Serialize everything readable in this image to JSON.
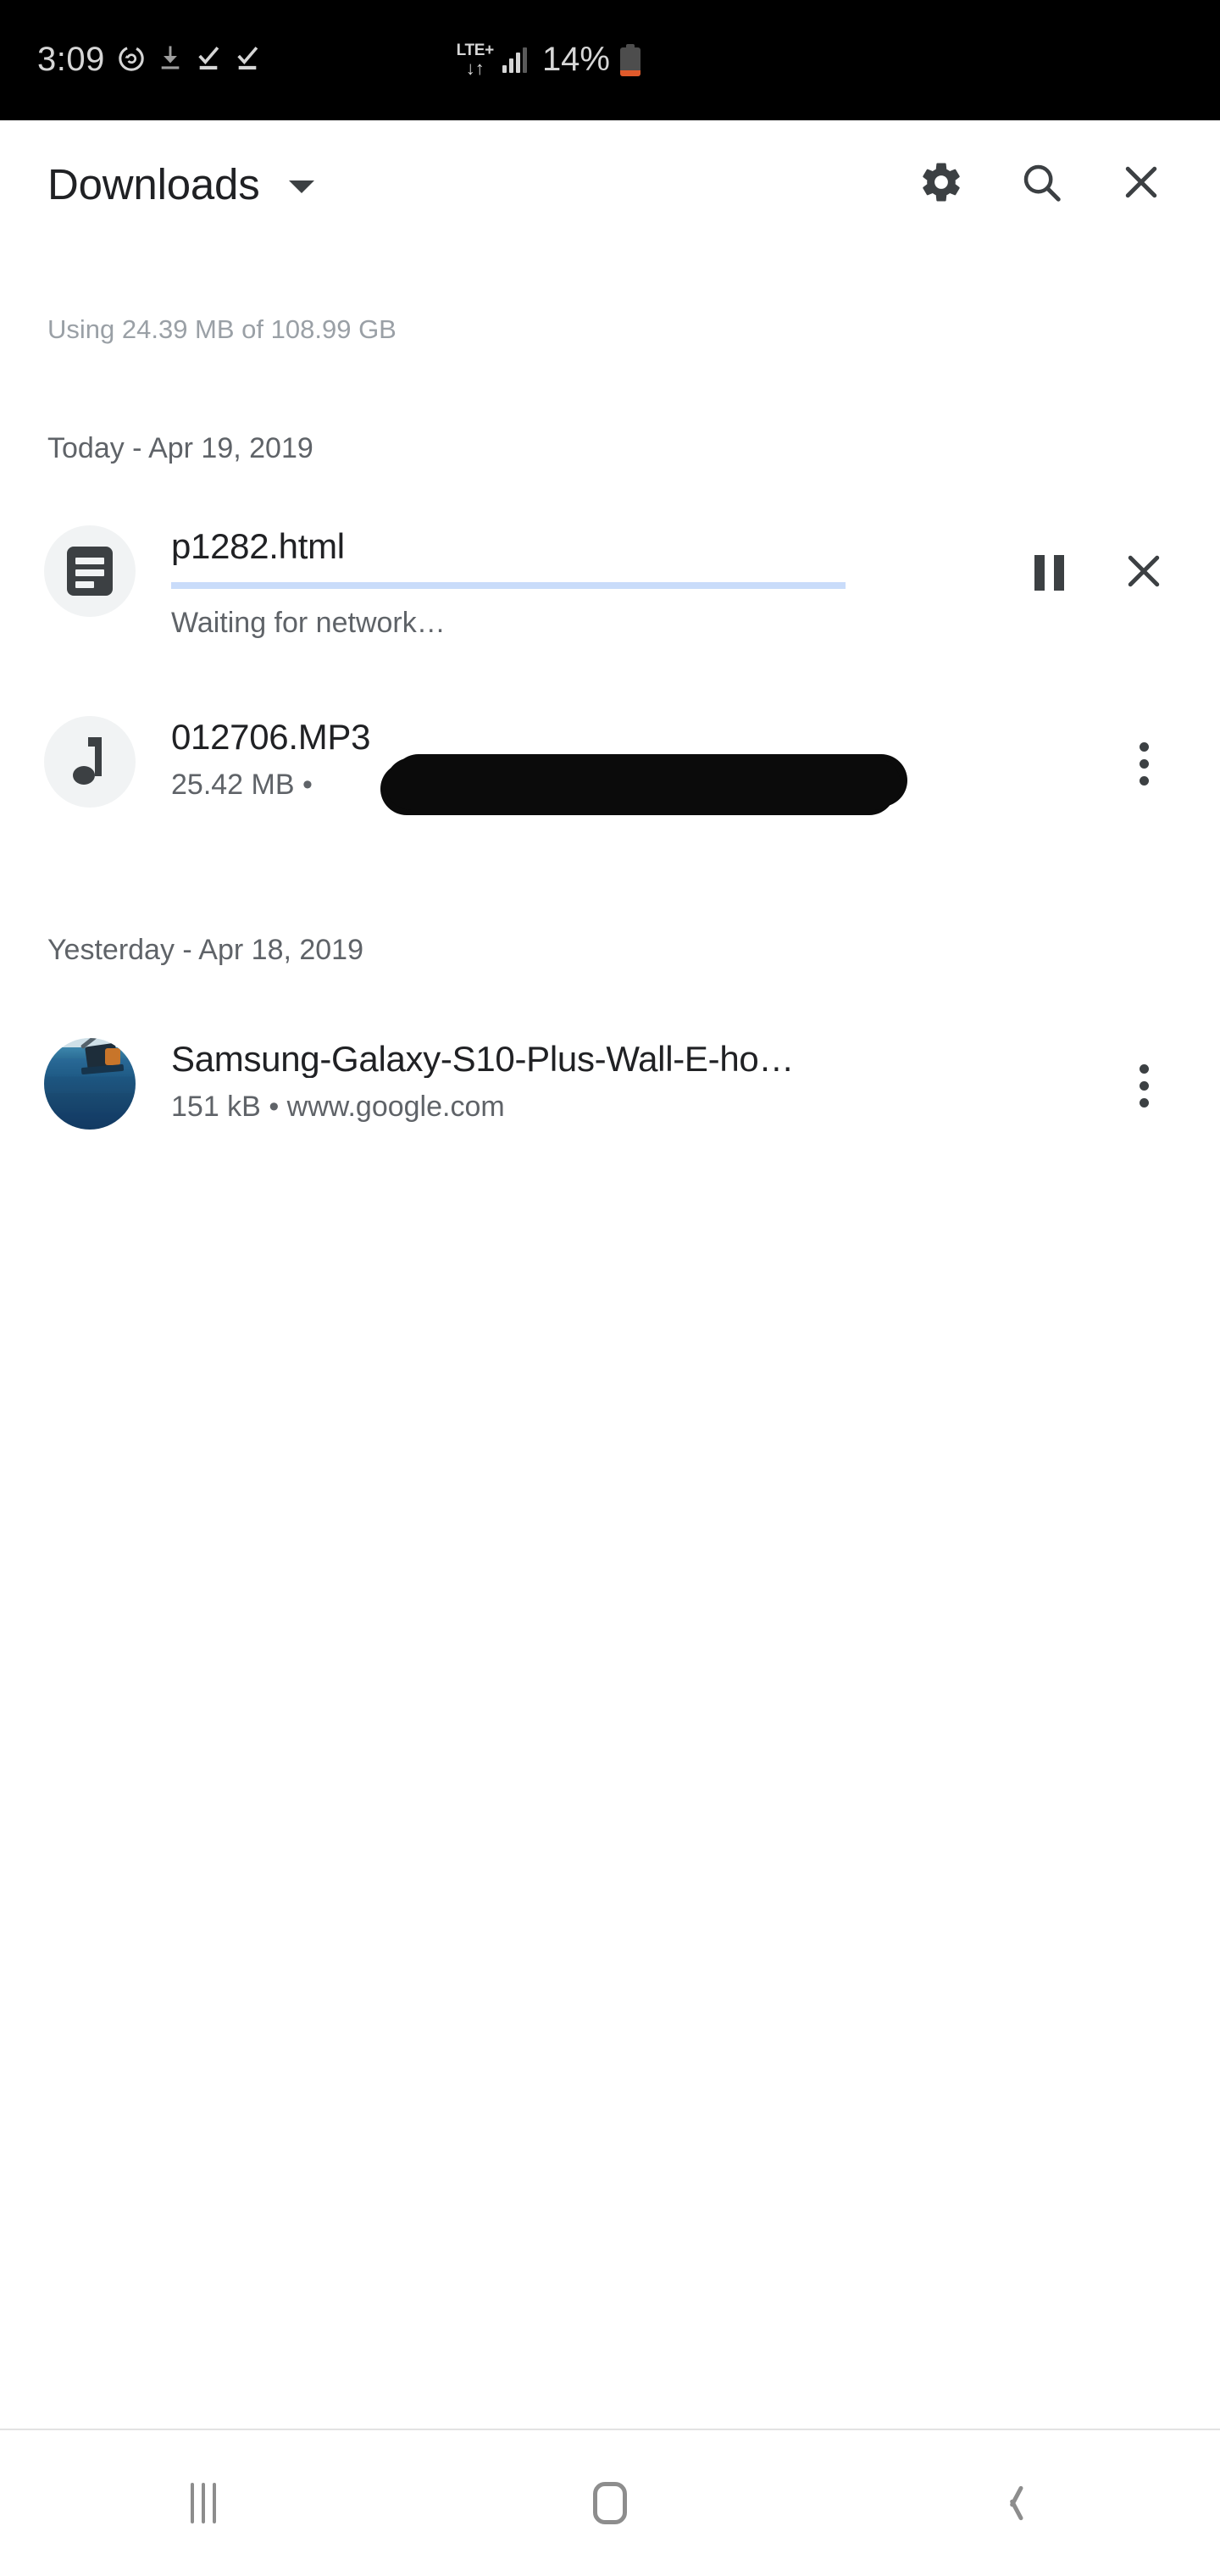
{
  "status_bar": {
    "time": "3:09",
    "icons_left": [
      "sync-icon",
      "download-arrow-icon",
      "download-complete-icon",
      "download-complete-icon"
    ],
    "network_type": "LTE+",
    "data_arrows": "↓↑",
    "signal_bars_filled": 3,
    "signal_bars_total": 4,
    "battery_percent": "14%",
    "battery_level": 14,
    "battery_color": "#e05a2b",
    "background": "#000000"
  },
  "toolbar": {
    "title": "Downloads",
    "dropdown_icon": "chevron-down-icon",
    "actions": [
      {
        "name": "settings",
        "icon": "gear-icon"
      },
      {
        "name": "search",
        "icon": "search-icon"
      },
      {
        "name": "close",
        "icon": "close-icon"
      }
    ]
  },
  "storage": {
    "usage_text": "Using 24.39 MB of 108.99 GB"
  },
  "sections": [
    {
      "id": "today",
      "label": "Today - Apr 19, 2019"
    },
    {
      "id": "yesterday",
      "label": "Yesterday - Apr 18, 2019"
    }
  ],
  "downloads": [
    {
      "file_name": "p1282.html",
      "icon": "document-icon",
      "status": "Waiting for network…",
      "in_progress": true,
      "progress_percent": 0,
      "progress_color": "#c9dcfa",
      "actions": [
        "pause-icon",
        "cancel-icon"
      ]
    },
    {
      "file_name": "012706.MP3",
      "icon": "music-note-icon",
      "size": "25.42 MB",
      "separator": "•",
      "source": "",
      "source_redacted": true,
      "in_progress": false,
      "actions": [
        "overflow-menu-icon"
      ]
    },
    {
      "file_name": "Samsung-Galaxy-S10-Plus-Wall-E-ho…",
      "icon": "image-thumbnail",
      "size": "151 kB",
      "separator": "•",
      "source": "www.google.com",
      "source_redacted": false,
      "in_progress": false,
      "actions": [
        "overflow-menu-icon"
      ]
    }
  ],
  "nav_bar": {
    "buttons": [
      {
        "name": "recents",
        "icon": "recents-icon"
      },
      {
        "name": "home",
        "icon": "home-icon"
      },
      {
        "name": "back",
        "icon": "back-icon"
      }
    ]
  }
}
